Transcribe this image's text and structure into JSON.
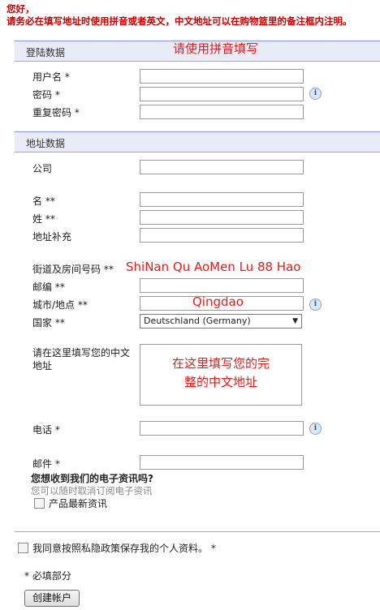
{
  "notice": {
    "line1": "您好，",
    "line2": "请务必在填写地址时使用拼音或者英文，中文地址可以在购物篮里的备注框内注明。"
  },
  "login_section": {
    "title": "登陆数据",
    "hint": "请使用拼音填写",
    "username_label": "用户名 *",
    "password_label": "密码 *",
    "repeat_password_label": "重复密码 *"
  },
  "address_section": {
    "title": "地址数据",
    "company_label": "公司",
    "firstname_label": "名 **",
    "lastname_label": "姓 **",
    "address_extra_label": "地址补充",
    "street_label": "街道及房间号码 **",
    "street_value": "ShiNan Qu AoMen Lu 88 Hao",
    "zip_label": "邮编 **",
    "city_label": "城市/地点 **",
    "city_value": "Qingdao",
    "country_label": "国家 **",
    "country_selected": "Deutschland (Germany)",
    "chinese_address_label_1": "请在这里填写您的中文",
    "chinese_address_label_2": "地址",
    "chinese_address_hint_1": "在这里填写您的完",
    "chinese_address_hint_2": "整的中文地址",
    "phone_label": "电话 *",
    "email_label": "邮件 *"
  },
  "newsletter": {
    "question": "您想收到我们的电子资讯吗?",
    "note": "您可以随时取消订阅电子资讯",
    "option_label": "产品最新资讯"
  },
  "privacy": {
    "label": "我同意按照私隐政策保存我的个人资料。 *"
  },
  "required_note": "* 必填部分",
  "submit_label": "创建帐户",
  "icons": {
    "info": "info-icon",
    "dropdown": "chevron-down-icon"
  },
  "colors": {
    "hint_red": "#e0201e",
    "notice_red": "#cc0000",
    "section_bg": "#e9ecf6"
  }
}
